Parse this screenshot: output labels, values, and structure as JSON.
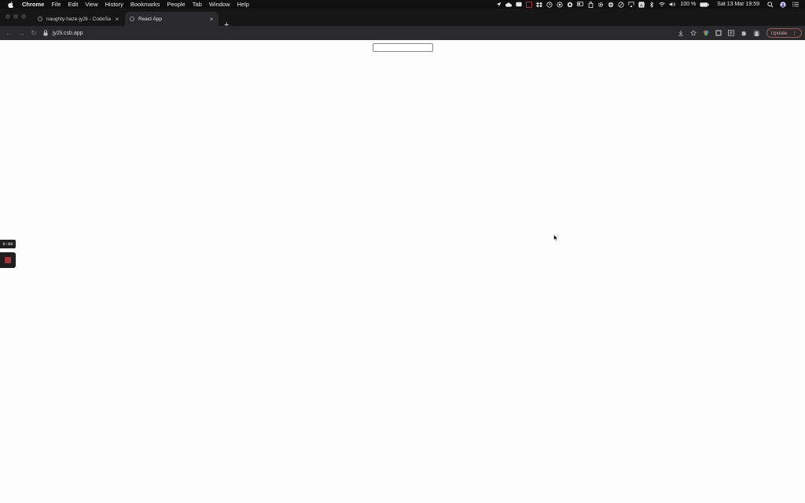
{
  "menubar": {
    "apple_icon": "apple-icon",
    "items": [
      "Chrome",
      "File",
      "Edit",
      "View",
      "History",
      "Bookmarks",
      "People",
      "Tab",
      "Window",
      "Help"
    ],
    "battery_text": "100 %",
    "datetime": "Sat 13 Mar  19:59"
  },
  "tabs": [
    {
      "title": "naughty-haze-jy2li - CodeSa",
      "close": "×"
    },
    {
      "title": "React App",
      "close": "×"
    }
  ],
  "newtab_label": "+",
  "toolbar": {
    "url": "jy2li.csb.app",
    "update_label": "Update",
    "update_menu": "⋮"
  },
  "page": {
    "input_value": "",
    "input_placeholder": ""
  },
  "recorder": {
    "timer": "0:00"
  },
  "colors": {
    "menubar_bg": "#0f0f10",
    "toolbar_bg": "#2a2a2c",
    "page_bg": "#fdfdfd",
    "record_accent": "#a8323a"
  }
}
